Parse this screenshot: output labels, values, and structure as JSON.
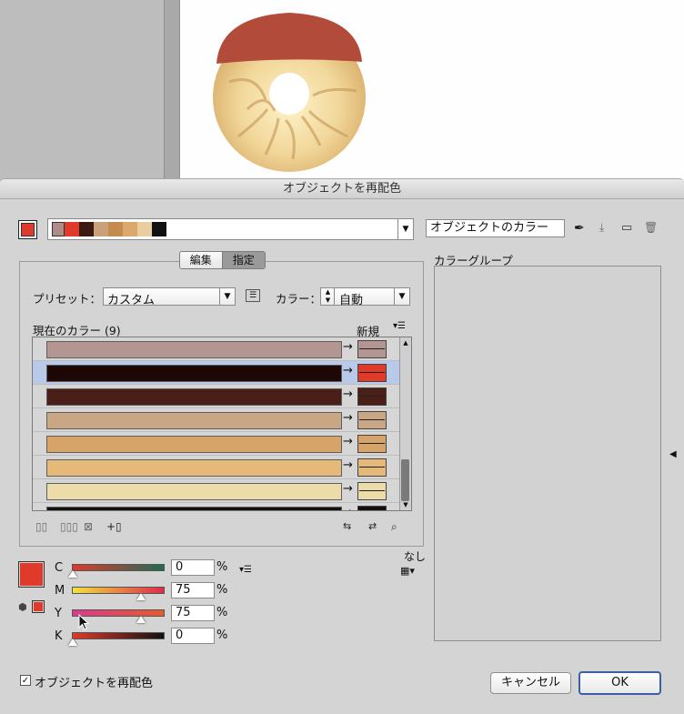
{
  "dialog": {
    "title": "オブジェクトを再配色",
    "color_group_name": "オブジェクトのカラー",
    "tabs": [
      {
        "label": "編集"
      },
      {
        "label": "指定"
      }
    ],
    "right_panel_label": "カラーグループ",
    "preset_label": "プリセット：",
    "preset_value": "カスタム",
    "colors_label": "カラー：",
    "colors_value": "自動",
    "current_colors_label": "現在のカラー (9)",
    "new_label": "新規",
    "none_label": "なし",
    "recolor_checkbox_label": "オブジェクトを再配色",
    "recolor_checked": true,
    "cancel_label": "キャンセル",
    "ok_label": "OK"
  },
  "group_strip": [
    "#b08c88",
    "#e03a2a",
    "#3a1a12",
    "#c9a07a",
    "#c48a4e",
    "#dba96a",
    "#e9cfa0",
    "#111111",
    "#ffffff"
  ],
  "accent_color": "#e03a2a",
  "color_rows": [
    {
      "current": "#b39591",
      "new": "#b39591",
      "selected": false
    },
    {
      "current": "#1e0805",
      "new": "#e03a2a",
      "selected": true
    },
    {
      "current": "#4a1f17",
      "new": "#4a1f17",
      "selected": false
    },
    {
      "current": "#c9a784",
      "new": "#c9a784",
      "selected": false
    },
    {
      "current": "#d6a468",
      "new": "#d6a468",
      "selected": false
    },
    {
      "current": "#e4b97a",
      "new": "#e4b97a",
      "selected": false
    },
    {
      "current": "#ecdcaa",
      "new": "#ecdcaa",
      "selected": false
    },
    {
      "current": "#111111",
      "new": "#111111",
      "selected": false
    }
  ],
  "cmyk": [
    {
      "label": "C",
      "value": "0",
      "unit": "%",
      "fraction": 0.0
    },
    {
      "label": "M",
      "value": "75",
      "unit": "%",
      "fraction": 0.75
    },
    {
      "label": "Y",
      "value": "75",
      "unit": "%",
      "fraction": 0.75
    },
    {
      "label": "K",
      "value": "0",
      "unit": "%",
      "fraction": 0.0
    }
  ]
}
